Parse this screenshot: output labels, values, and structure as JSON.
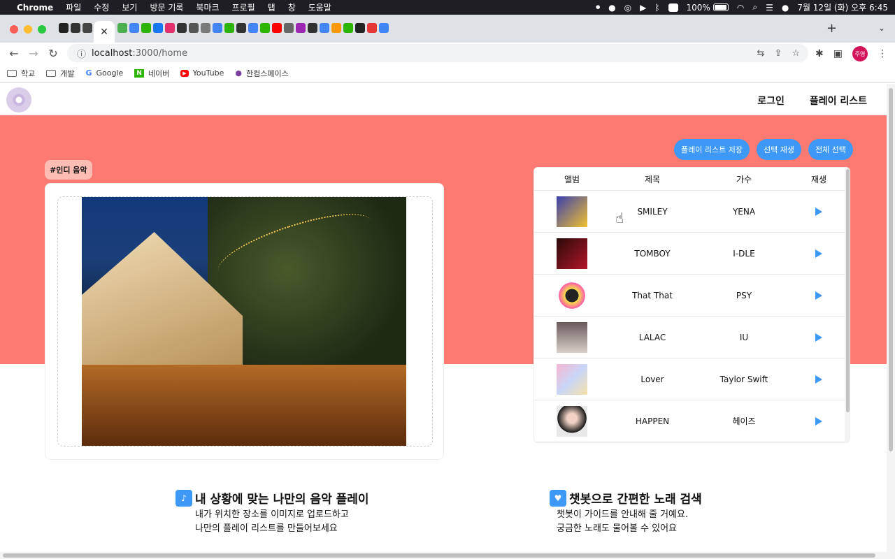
{
  "menubar": {
    "app": "Chrome",
    "items": [
      "파일",
      "수정",
      "보기",
      "방문 기록",
      "북마크",
      "프로필",
      "탭",
      "창",
      "도움말"
    ],
    "battery": "100%",
    "datetime": "7월 12일 (화) 오후 6:45"
  },
  "browser": {
    "url_host": "localhost",
    "url_path": ":3000/home",
    "profile_initials": "주영",
    "bookmarks": [
      "학교",
      "개발",
      "Google",
      "네이버",
      "YouTube",
      "한컴스페이스"
    ]
  },
  "site": {
    "nav": {
      "login": "로그인",
      "playlist": "플레이 리스트"
    },
    "actions": {
      "save_playlist": "플레이 리스트 저장",
      "play_selected": "선택 재생",
      "select_all": "전체 선택"
    },
    "tag": "#인디 음악",
    "table": {
      "headers": [
        "앨범",
        "제목",
        "가수",
        "재생"
      ],
      "rows": [
        {
          "title": "SMILEY",
          "artist": "YENA"
        },
        {
          "title": "TOMBOY",
          "artist": "I-DLE"
        },
        {
          "title": "That That",
          "artist": "PSY"
        },
        {
          "title": "LALAC",
          "artist": "IU"
        },
        {
          "title": "Lover",
          "artist": "Taylor Swift"
        },
        {
          "title": "HAPPEN",
          "artist": "헤이즈"
        }
      ]
    },
    "features": [
      {
        "title": "내 상황에 맞는 나만의 음악 플레이",
        "lines": [
          "내가 위치한 장소를 이미지로 업로드하고",
          "나만의 플레이 리스트를 만들어보세요"
        ]
      },
      {
        "title": "챗봇으로 간편한 노래 검색",
        "lines": [
          "챗봇이 가이드를 안내해 줄 거예요.",
          "궁금한 노래도 물어볼 수 있어요"
        ]
      }
    ]
  },
  "colors": {
    "hero": "#fc7a71",
    "accent": "#3d99f5",
    "tag": "#fdbdb5"
  }
}
